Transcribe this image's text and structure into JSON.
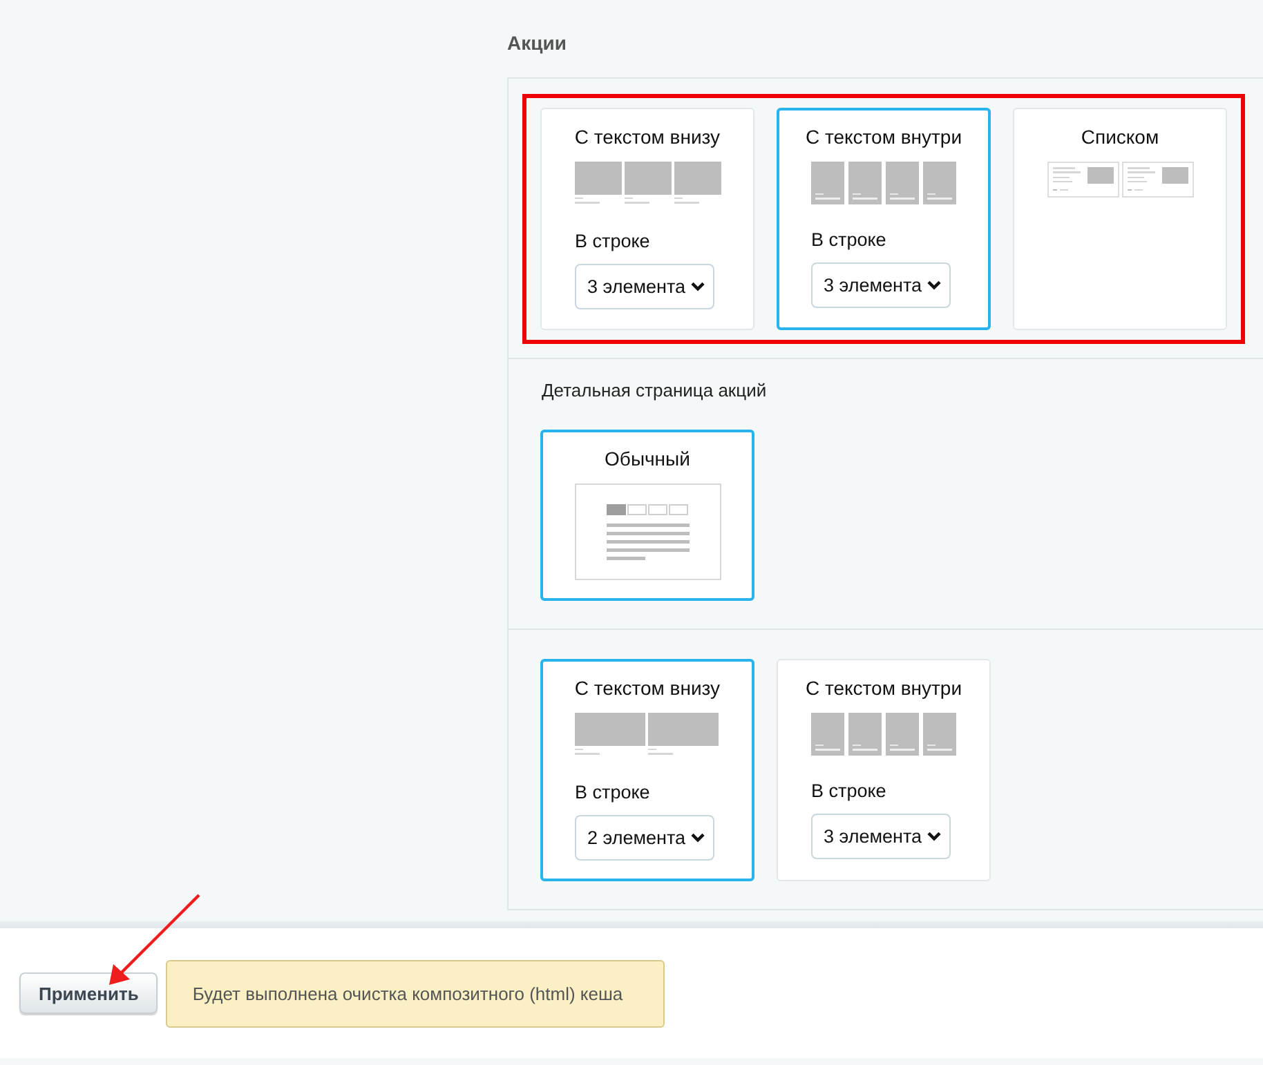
{
  "section_title": "Акции",
  "groups": [
    {
      "highlighted": true,
      "options": [
        {
          "label": "С текстом внизу",
          "kind": "below",
          "selected": false,
          "per_row": {
            "label": "В строке",
            "value": "3 элемента"
          }
        },
        {
          "label": "С текстом внутри",
          "kind": "inside",
          "selected": true,
          "per_row": {
            "label": "В строке",
            "value": "3 элемента"
          }
        },
        {
          "label": "Списком",
          "kind": "list",
          "selected": false
        }
      ]
    },
    {
      "highlighted": false,
      "label": "Детальная страница акций",
      "options": [
        {
          "label": "Обычный",
          "kind": "detail",
          "selected": true
        }
      ]
    },
    {
      "highlighted": false,
      "options": [
        {
          "label": "С текстом внизу",
          "kind": "belowwide",
          "selected": true,
          "per_row": {
            "label": "В строке",
            "value": "2 элемента"
          }
        },
        {
          "label": "С текстом внутри",
          "kind": "inside",
          "selected": false,
          "per_row": {
            "label": "В строке",
            "value": "3 элемента"
          }
        }
      ]
    }
  ],
  "footer": {
    "apply_button": {
      "label": "Применить",
      "pointed": true
    },
    "note": "Будет выполнена очистка композитного (html) кеша"
  }
}
